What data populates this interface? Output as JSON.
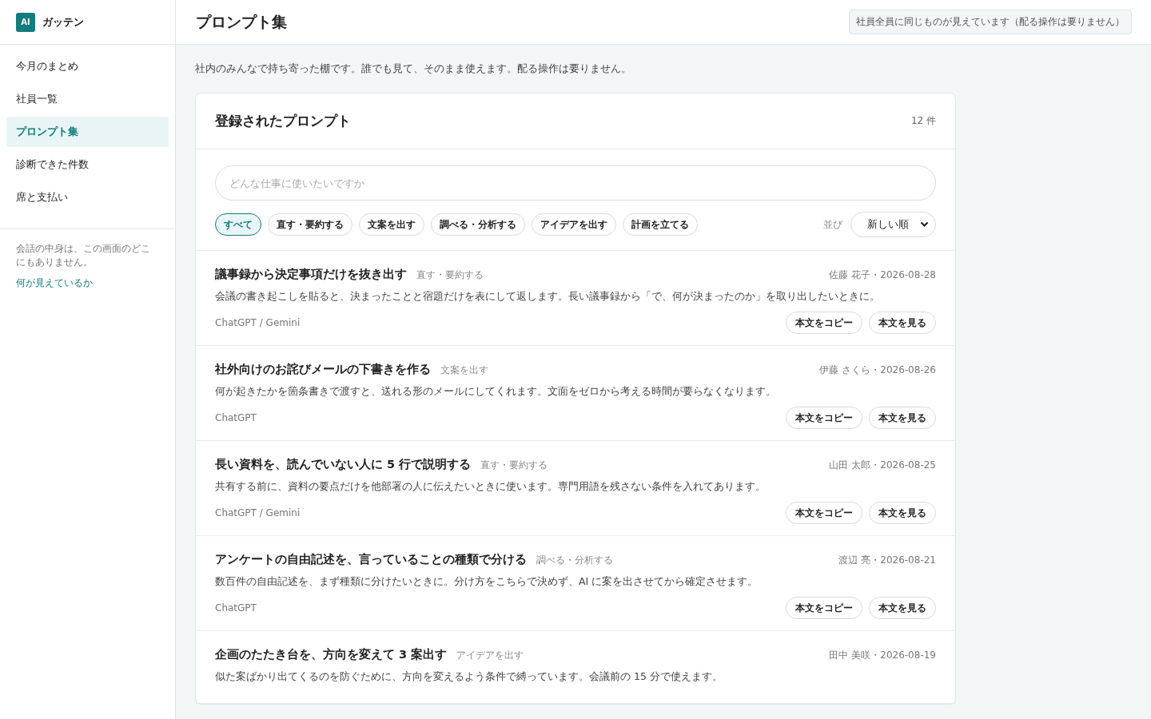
{
  "sidebar": {
    "logo_badge": "AI",
    "app_name": "ガッテン",
    "items": [
      {
        "label": "今月のまとめ",
        "selected": false
      },
      {
        "label": "社員一覧",
        "selected": false
      },
      {
        "label": "プロンプト集",
        "selected": true
      },
      {
        "label": "診断できた件数",
        "selected": false
      },
      {
        "label": "席と支払い",
        "selected": false
      }
    ],
    "note": "会話の中身は、この画面のどこにもありません。",
    "note_link": "何が見えているか"
  },
  "header": {
    "title": "プロンプト集",
    "notice": "社員全員に同じものが見えています（配る操作は要りません）"
  },
  "intro": "社内のみんなで持ち寄った棚です。誰でも見て、そのまま使えます。配る操作は要りません。",
  "card": {
    "title": "登録されたプロンプト",
    "count": "12 件",
    "search": {
      "placeholder": "どんな仕事に使いたいですか"
    },
    "filters": [
      {
        "label": "すべて",
        "selected": true
      },
      {
        "label": "直す・要約する",
        "selected": false
      },
      {
        "label": "文案を出す",
        "selected": false
      },
      {
        "label": "調べる・分析する",
        "selected": false
      },
      {
        "label": "アイデアを出す",
        "selected": false
      },
      {
        "label": "計画を立てる",
        "selected": false
      }
    ],
    "sort_label": "並び",
    "sort_value": "新しい順",
    "prompts": [
      {
        "title": "議事録から決定事項だけを抜き出す",
        "category": "直す・要約する",
        "meta": "佐藤 花子・2026-08-28",
        "description": "会議の書き起こしを貼ると、決まったことと宿題だけを表にして返します。長い議事録から「で、何が決まったのか」を取り出したいときに。",
        "tools": "ChatGPT / Gemini",
        "buttons": [
          "本文をコピー",
          "本文を見る"
        ]
      },
      {
        "title": "社外向けのお詫びメールの下書きを作る",
        "category": "文案を出す",
        "meta": "伊藤 さくら・2026-08-26",
        "description": "何が起きたかを箇条書きで渡すと、送れる形のメールにしてくれます。文面をゼロから考える時間が要らなくなります。",
        "tools": "ChatGPT",
        "buttons": [
          "本文をコピー",
          "本文を見る"
        ]
      },
      {
        "title": "長い資料を、読んでいない人に 5 行で説明する",
        "category": "直す・要約する",
        "meta": "山田 太郎・2026-08-25",
        "description": "共有する前に、資料の要点だけを他部署の人に伝えたいときに使います。専門用語を残さない条件を入れてあります。",
        "tools": "ChatGPT / Gemini",
        "buttons": [
          "本文をコピー",
          "本文を見る"
        ]
      },
      {
        "title": "アンケートの自由記述を、言っていることの種類で分ける",
        "category": "調べる・分析する",
        "meta": "渡辺 亮・2026-08-21",
        "description": "数百件の自由記述を、まず種類に分けたいときに。分け方をこちらで決めず、AI に案を出させてから確定させます。",
        "tools": "ChatGPT",
        "buttons": [
          "本文をコピー",
          "本文を見る"
        ]
      },
      {
        "title": "企画のたたき台を、方向を変えて 3 案出す",
        "category": "アイデアを出す",
        "meta": "田中 美咲・2026-08-19",
        "description": "似た案ばかり出てくるのを防ぐために、方向を変えるよう条件で縛っています。会議前の 15 分で使えます。"
      }
    ]
  }
}
